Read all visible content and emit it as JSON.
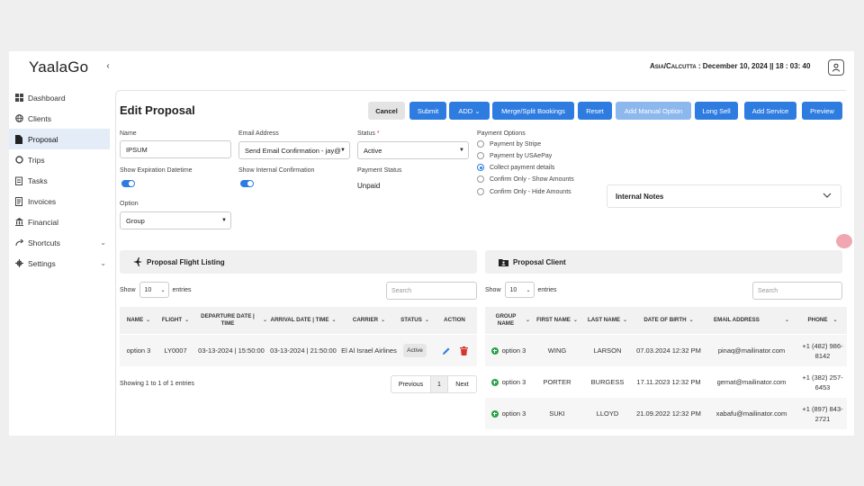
{
  "app": {
    "logo": "YaalaGo",
    "timezone": "Asia/Calcutta",
    "clock": ": December 10, 2024 || 18 : 03: 40"
  },
  "sidebar": {
    "items": [
      {
        "label": "Dashboard",
        "icon": "dashboard-icon"
      },
      {
        "label": "Clients",
        "icon": "globe-icon"
      },
      {
        "label": "Proposal",
        "icon": "file-icon",
        "active": true
      },
      {
        "label": "Trips",
        "icon": "circle-icon"
      },
      {
        "label": "Tasks",
        "icon": "clipboard-icon"
      },
      {
        "label": "Invoices",
        "icon": "invoice-icon"
      },
      {
        "label": "Financial",
        "icon": "bank-icon"
      },
      {
        "label": "Shortcuts",
        "icon": "share-icon"
      },
      {
        "label": "Settings",
        "icon": "gear-icon"
      }
    ]
  },
  "page": {
    "title": "Edit Proposal"
  },
  "toolbar": {
    "cancel": "Cancel",
    "submit": "Submit",
    "add": "ADD",
    "merge": "Merge/Split Bookings",
    "reset": "Reset",
    "add_manual": "Add Manual Option",
    "long_sell": "Long Sell",
    "add_service": "Add Service",
    "preview": "Preview"
  },
  "form": {
    "name_label": "Name",
    "name_value": "IPSUM",
    "email_label": "Email Address",
    "email_value": "Send Email Confirmation - jay@",
    "status_label": "Status",
    "status_required": "*",
    "status_value": "Active",
    "show_expiration_label": "Show Expiration Datetime",
    "show_internal_label": "Show Internal Confirmation",
    "payment_status_label": "Payment Status",
    "payment_status_value": "Unpaid",
    "option_label": "Option",
    "option_value": "Group",
    "payment_options_label": "Payment Options",
    "payment_options": [
      {
        "label": "Payment by Stripe",
        "selected": false
      },
      {
        "label": "Payment by USAePay",
        "selected": false
      },
      {
        "label": "Collect payment details",
        "selected": true
      },
      {
        "label": "Confirm Only - Show Amounts",
        "selected": false
      },
      {
        "label": "Confirm Only - Hide Amounts",
        "selected": false
      }
    ],
    "internal_notes": "Internal Notes"
  },
  "flights": {
    "title": "Proposal Flight Listing",
    "show": "Show",
    "entries_value": "10",
    "entries": "entries",
    "search_placeholder": "Search",
    "headers": [
      "NAME",
      "FLIGHT",
      "DEPARTURE DATE | TIME",
      "ARRIVAL DATE | TIME",
      "CARRIER",
      "STATUS",
      "ACTION"
    ],
    "rows": [
      {
        "name": "option 3",
        "flight": "LY0007",
        "departure": "03-13-2024 | 15:50:00",
        "arrival": "03-13-2024 | 21:50:00",
        "carrier": "El Al Israel Airlines",
        "status": "Active"
      }
    ],
    "showing": "Showing 1 to 1 of 1 entries",
    "prev": "Previous",
    "page": "1",
    "next": "Next"
  },
  "clients": {
    "title": "Proposal Client",
    "show": "Show",
    "entries_value": "10",
    "entries": "entries",
    "search_placeholder": "Search",
    "headers": [
      "GROUP NAME",
      "FIRST NAME",
      "LAST NAME",
      "DATE OF BIRTH",
      "EMAIL ADDRESS",
      "PHONE"
    ],
    "rows": [
      {
        "group": "option 3",
        "first": "WING",
        "last": "LARSON",
        "dob": "07.03.2024 12:32 PM",
        "email": "pinaq@mailinator.com",
        "phone": "+1 (482) 986-8142"
      },
      {
        "group": "option 3",
        "first": "PORTER",
        "last": "BURGESS",
        "dob": "17.11.2023 12:32 PM",
        "email": "gemat@mailinator.com",
        "phone": "+1 (382) 257-6453"
      },
      {
        "group": "option 3",
        "first": "SUKI",
        "last": "LLOYD",
        "dob": "21.09.2022 12:32 PM",
        "email": "xabafu@mailinator.com",
        "phone": "+1 (897) 843-2721"
      }
    ]
  },
  "colors": {
    "primary": "#2e7ce0",
    "light_primary": "#8cb8ee",
    "success": "#2aa248",
    "danger": "#d9342b"
  }
}
